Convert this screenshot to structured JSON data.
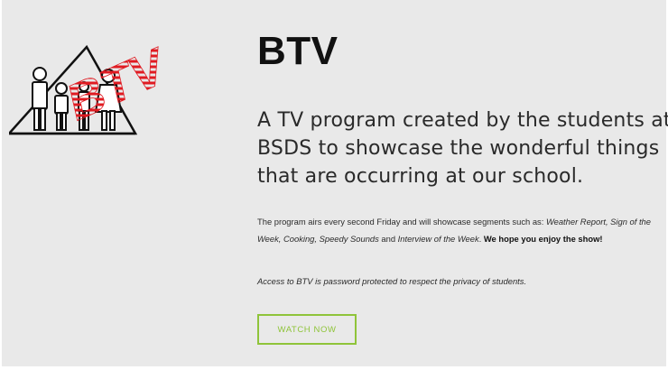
{
  "logo": {
    "icon": "btv-family-logo-icon",
    "text": "BTV",
    "accent_color": "#e01b22"
  },
  "header": {
    "title": "BTV"
  },
  "main": {
    "tagline": "A TV program created by the students at BSDS to showcase the wonderful things that are occurring at our school.",
    "description": {
      "intro": "The program airs every second Friday and will showcase segments such as: ",
      "segments": "Weather Report, Sign of the Week, Cooking, Speedy Sounds",
      "and": " and ",
      "last_segment": "Interview of the Week",
      "period": ". ",
      "closing": "We hope you enjoy the show!"
    },
    "privacy_note": "Access to BTV is password protected to respect the privacy of students.",
    "watch_button": {
      "label": "watch now",
      "color": "#8fc43a"
    }
  }
}
